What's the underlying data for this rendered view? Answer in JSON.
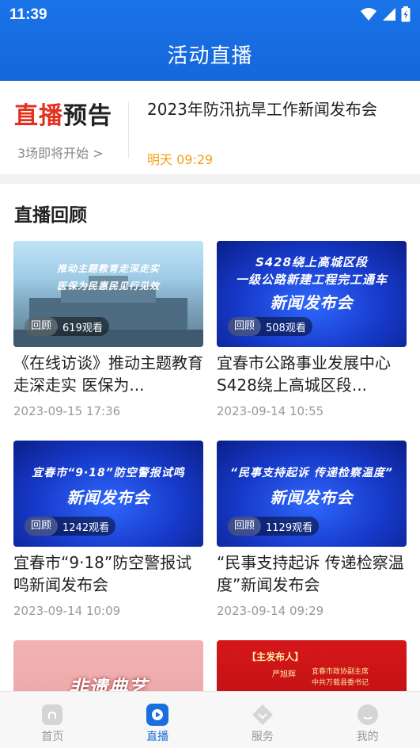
{
  "status_bar": {
    "time": "11:39"
  },
  "header": {
    "title": "活动直播"
  },
  "preview": {
    "logo_red": "直播",
    "logo_black": "预告",
    "count_text": "3场即将开始 >",
    "event_title": "2023年防汛抗旱工作新闻发布会",
    "event_time": "明天 09:29"
  },
  "section": {
    "title": "直播回顾"
  },
  "cards": [
    {
      "thumb_text": [
        "推动主题教育走深走实",
        "医保为民惠民见行见效"
      ],
      "badge": "回顾",
      "views": "619观看",
      "title": "《在线访谈》推动主题教育走深走实 医保为...",
      "date": "2023-09-15 17:36"
    },
    {
      "thumb_text": [
        "S428绕上高城区段",
        "一级公路新建工程完工通车",
        "新闻发布会"
      ],
      "badge": "回顾",
      "views": "508观看",
      "title": "宜春市公路事业发展中心S428绕上高城区段...",
      "date": "2023-09-14 10:55"
    },
    {
      "thumb_text": [
        "宜春市“9·18”防空警报试鸣",
        "新闻发布会"
      ],
      "badge": "回顾",
      "views": "1242观看",
      "title": "宜春市“9·18”防空警报试鸣新闻发布会",
      "date": "2023-09-14 10:09"
    },
    {
      "thumb_text": [
        "“民事支持起诉 传递检察温度”",
        "新闻发布会"
      ],
      "badge": "回顾",
      "views": "1129观看",
      "title": "“民事支持起诉 传递检察温度”新闻发布会",
      "date": "2023-09-14 09:29"
    },
    {
      "thumb_text": [
        "非遗典艺"
      ]
    },
    {
      "thumb_text": [
        "【主发布人】",
        "严旭辉",
        "宜春市政协副主席",
        "中共万载县委书记"
      ]
    }
  ],
  "tabs": [
    {
      "label": "首页",
      "icon": "home-icon"
    },
    {
      "label": "直播",
      "icon": "live-icon"
    },
    {
      "label": "服务",
      "icon": "service-icon"
    },
    {
      "label": "我的",
      "icon": "profile-icon"
    }
  ],
  "colors": {
    "primary": "#1a6fe0",
    "accent_orange": "#f0a21a",
    "logo_red": "#e2321f"
  }
}
